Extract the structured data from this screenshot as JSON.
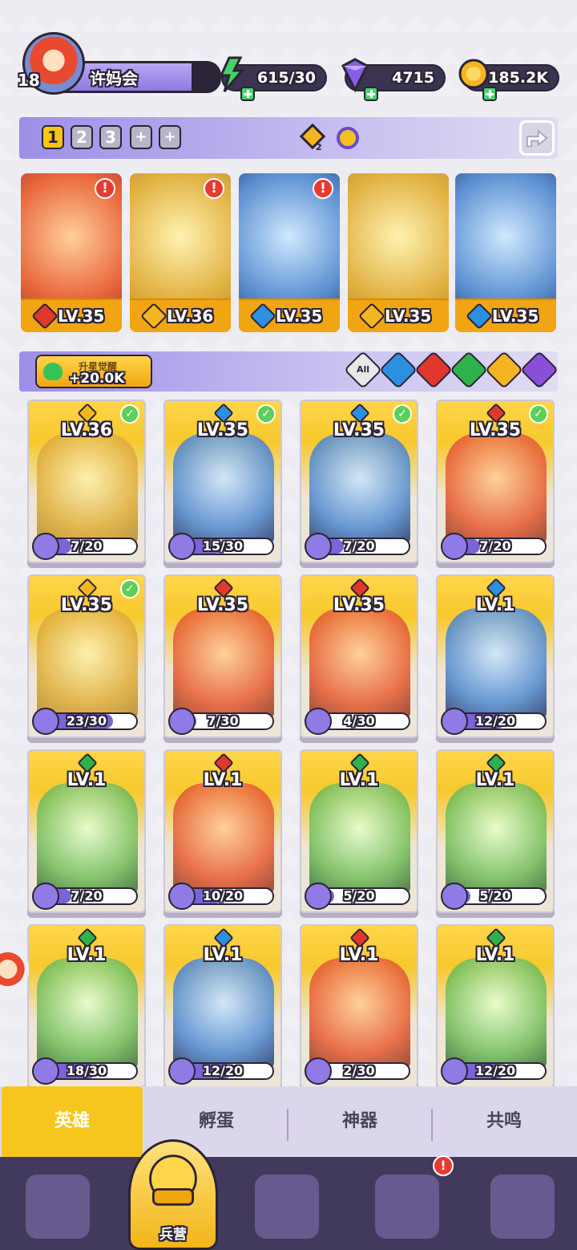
{
  "player": {
    "level": "18",
    "name": "许妈会"
  },
  "resources": {
    "energy": "615/30",
    "gems": "4715",
    "coins": "185.2K"
  },
  "teams": {
    "tabs": [
      "1",
      "2",
      "3",
      "+",
      "+"
    ],
    "active_index": 0,
    "badge_count": "2"
  },
  "team_lineup": [
    {
      "level": "LV.35",
      "element": "fire",
      "alert": "!"
    },
    {
      "level": "LV.36",
      "element": "light",
      "alert": "!"
    },
    {
      "level": "LV.35",
      "element": "water",
      "alert": "!"
    },
    {
      "level": "LV.35",
      "element": "light",
      "alert": ""
    },
    {
      "level": "LV.35",
      "element": "water",
      "alert": ""
    }
  ],
  "awakening": {
    "label": "升星觉醒",
    "value": "+20.0K"
  },
  "filters": {
    "all_label": "All",
    "elements": [
      "water",
      "fire",
      "earth",
      "light",
      "dark"
    ]
  },
  "heroes": [
    {
      "level": "LV.36",
      "element": "light",
      "frag": "7/20",
      "progress": 0.35,
      "checked": true
    },
    {
      "level": "LV.35",
      "element": "water",
      "frag": "15/30",
      "progress": 0.5,
      "checked": true
    },
    {
      "level": "LV.35",
      "element": "water",
      "frag": "7/20",
      "progress": 0.35,
      "checked": true
    },
    {
      "level": "LV.35",
      "element": "fire",
      "frag": "7/20",
      "progress": 0.35,
      "checked": true
    },
    {
      "level": "LV.35",
      "element": "light",
      "frag": "23/30",
      "progress": 0.77,
      "checked": true
    },
    {
      "level": "LV.35",
      "element": "fire",
      "frag": "7/30",
      "progress": 0.23,
      "checked": false
    },
    {
      "level": "LV.35",
      "element": "fire",
      "frag": "4/30",
      "progress": 0.13,
      "checked": false
    },
    {
      "level": "LV.1",
      "element": "water",
      "frag": "12/20",
      "progress": 0.6,
      "checked": false
    },
    {
      "level": "LV.1",
      "element": "earth",
      "frag": "7/20",
      "progress": 0.35,
      "checked": false
    },
    {
      "level": "LV.1",
      "element": "fire",
      "frag": "10/20",
      "progress": 0.5,
      "checked": false
    },
    {
      "level": "LV.1",
      "element": "earth",
      "frag": "5/20",
      "progress": 0.25,
      "checked": false
    },
    {
      "level": "LV.1",
      "element": "earth",
      "frag": "5/20",
      "progress": 0.25,
      "checked": false
    },
    {
      "level": "LV.1",
      "element": "earth",
      "frag": "18/30",
      "progress": 0.6,
      "checked": false
    },
    {
      "level": "LV.1",
      "element": "water",
      "frag": "12/20",
      "progress": 0.6,
      "checked": false
    },
    {
      "level": "LV.1",
      "element": "fire",
      "frag": "2/30",
      "progress": 0.07,
      "checked": false
    },
    {
      "level": "LV.1",
      "element": "earth",
      "frag": "12/20",
      "progress": 0.6,
      "checked": false
    }
  ],
  "subtabs": [
    "英雄",
    "孵蛋",
    "神器",
    "共鸣"
  ],
  "nav": {
    "center_label": "兵营",
    "alert": "!"
  }
}
